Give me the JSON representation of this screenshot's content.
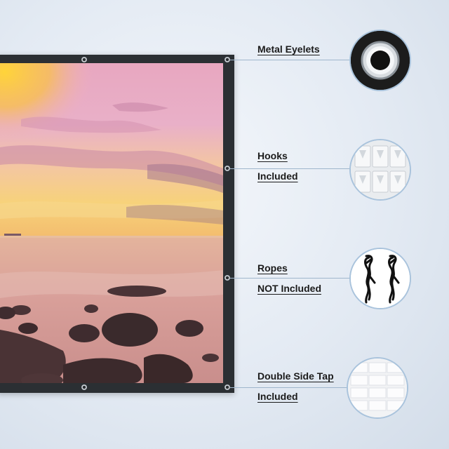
{
  "features": [
    {
      "id": "eyelets",
      "lines": [
        "Metal Eyelets"
      ],
      "icon": "metal-eyelet-icon"
    },
    {
      "id": "hooks",
      "lines": [
        "Hooks",
        "Included"
      ],
      "icon": "hooks-icon"
    },
    {
      "id": "ropes",
      "lines": [
        "Ropes",
        "NOT Included"
      ],
      "icon": "ropes-icon"
    },
    {
      "id": "tape",
      "lines": [
        "Double Side Tap",
        "Included"
      ],
      "icon": "double-side-tape-icon"
    }
  ],
  "colors": {
    "frame": "#2b2f33",
    "connector": "#9fb6cc",
    "circle_border": "#a9c3dc",
    "label_text": "#1b1b1b"
  }
}
